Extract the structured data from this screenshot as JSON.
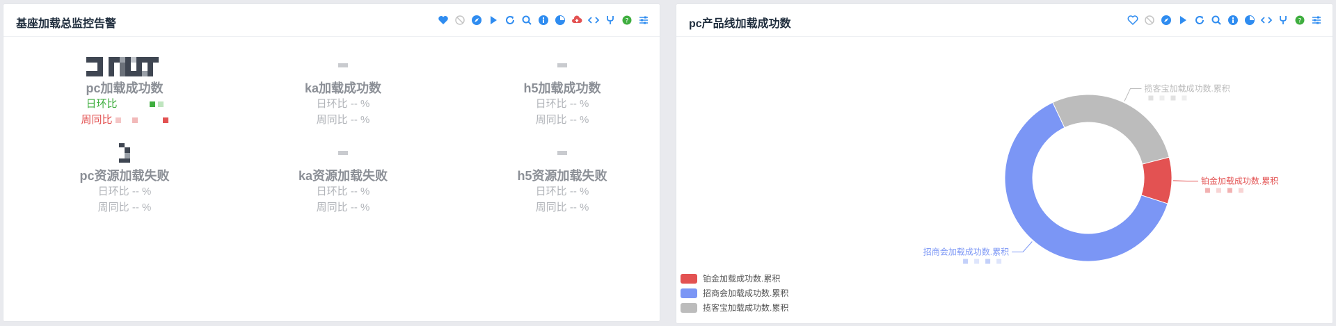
{
  "left_panel": {
    "title": "基座加载总监控告警",
    "stats_row1": [
      {
        "label": "pc加载成功数",
        "value": "",
        "day_ratio": "日环比",
        "week_ratio": "周同比",
        "day_value": "",
        "week_value": ""
      },
      {
        "label": "ka加载成功数",
        "value": "-",
        "day_ratio": "日环比 -- %",
        "week_ratio": "周同比 -- %"
      },
      {
        "label": "h5加载成功数",
        "value": "-",
        "day_ratio": "日环比 -- %",
        "week_ratio": "周同比 -- %"
      }
    ],
    "stats_row2": [
      {
        "label": "pc资源加载失败",
        "value": "",
        "day_ratio": "日环比 -- %",
        "week_ratio": "周同比 -- %"
      },
      {
        "label": "ka资源加载失败",
        "value": "-",
        "day_ratio": "日环比 -- %",
        "week_ratio": "周同比 -- %"
      },
      {
        "label": "h5资源加载失败",
        "value": "-",
        "day_ratio": "日环比 -- %",
        "week_ratio": "周同比 -- %"
      }
    ]
  },
  "right_panel": {
    "title": "pc产品线加载成功数"
  },
  "toolbar_icons": [
    "heart-icon",
    "ban-icon",
    "compass-icon",
    "play-icon",
    "refresh-icon",
    "search-icon",
    "info-icon",
    "pie-icon",
    "cloud-upload-icon",
    "code-icon",
    "fork-icon",
    "status-dot-icon",
    "sliders-icon"
  ],
  "colors": {
    "accent": "#2f8cf0",
    "red": "#e35252",
    "blue": "#7b96f5",
    "gray": "#bcbcbc",
    "green": "#3fae3f"
  },
  "chart_data": {
    "type": "pie",
    "title": "",
    "series": [
      {
        "name": "铂金加载成功数.累积",
        "value": 9,
        "color": "#e35252"
      },
      {
        "name": "招商会加载成功数.累积",
        "value": 63,
        "color": "#7b96f5"
      },
      {
        "name": "揽客宝加载成功数.累积",
        "value": 28,
        "color": "#bcbcbc"
      }
    ],
    "legend": "bottom-left",
    "donut": true
  }
}
